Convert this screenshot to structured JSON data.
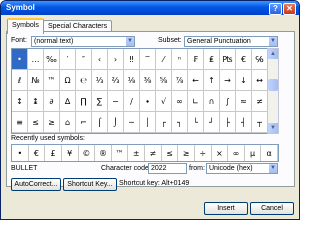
{
  "window": {
    "title": "Symbol",
    "help_glyph": "?",
    "close_glyph": "✕"
  },
  "tabs": [
    {
      "label": "Symbols"
    },
    {
      "label": "Special Characters"
    }
  ],
  "font": {
    "label": "Font:",
    "value": "(normal text)"
  },
  "subset": {
    "label": "Subset:",
    "value": "General Punctuation"
  },
  "symbol_grid": {
    "rows": [
      [
        "•",
        "…",
        "‰",
        "′",
        "″",
        "‹",
        "›",
        "‼",
        "‾",
        "⁄",
        "ⁿ",
        "₣",
        "₤",
        "₧",
        "€",
        "℅"
      ],
      [
        "ℓ",
        "№",
        "™",
        "Ω",
        "℮",
        "⅓",
        "⅔",
        "⅛",
        "⅜",
        "⅝",
        "⅞",
        "←",
        "↑",
        "→",
        "↓",
        "↔"
      ],
      [
        "↕",
        "↨",
        "∂",
        "∆",
        "∏",
        "∑",
        "−",
        "∕",
        "∙",
        "√",
        "∞",
        "∟",
        "∩",
        "∫",
        "≈",
        "≠"
      ],
      [
        "≡",
        "≤",
        "≥",
        "⌂",
        "⌐",
        "⌠",
        "⌡",
        "─",
        "│",
        "┌",
        "┐",
        "└",
        "┘",
        "├",
        "┤",
        "┬"
      ]
    ],
    "selected": "•"
  },
  "recent": {
    "label": "Recently used symbols:",
    "items": [
      "•",
      "€",
      "£",
      "¥",
      "©",
      "®",
      "™",
      "±",
      "≠",
      "≤",
      "≥",
      "÷",
      "×",
      "∞",
      "µ",
      "α"
    ]
  },
  "char_name": "BULLET",
  "char_code": {
    "label": "Character code:",
    "value": "2022"
  },
  "from": {
    "label": "from:",
    "value": "Unicode (hex)"
  },
  "buttons": {
    "autocorrect": "AutoCorrect...",
    "shortcut_key": "Shortcut Key...",
    "insert": "Insert",
    "cancel": "Cancel"
  },
  "shortcut_text": "Shortcut key: Alt+0149"
}
